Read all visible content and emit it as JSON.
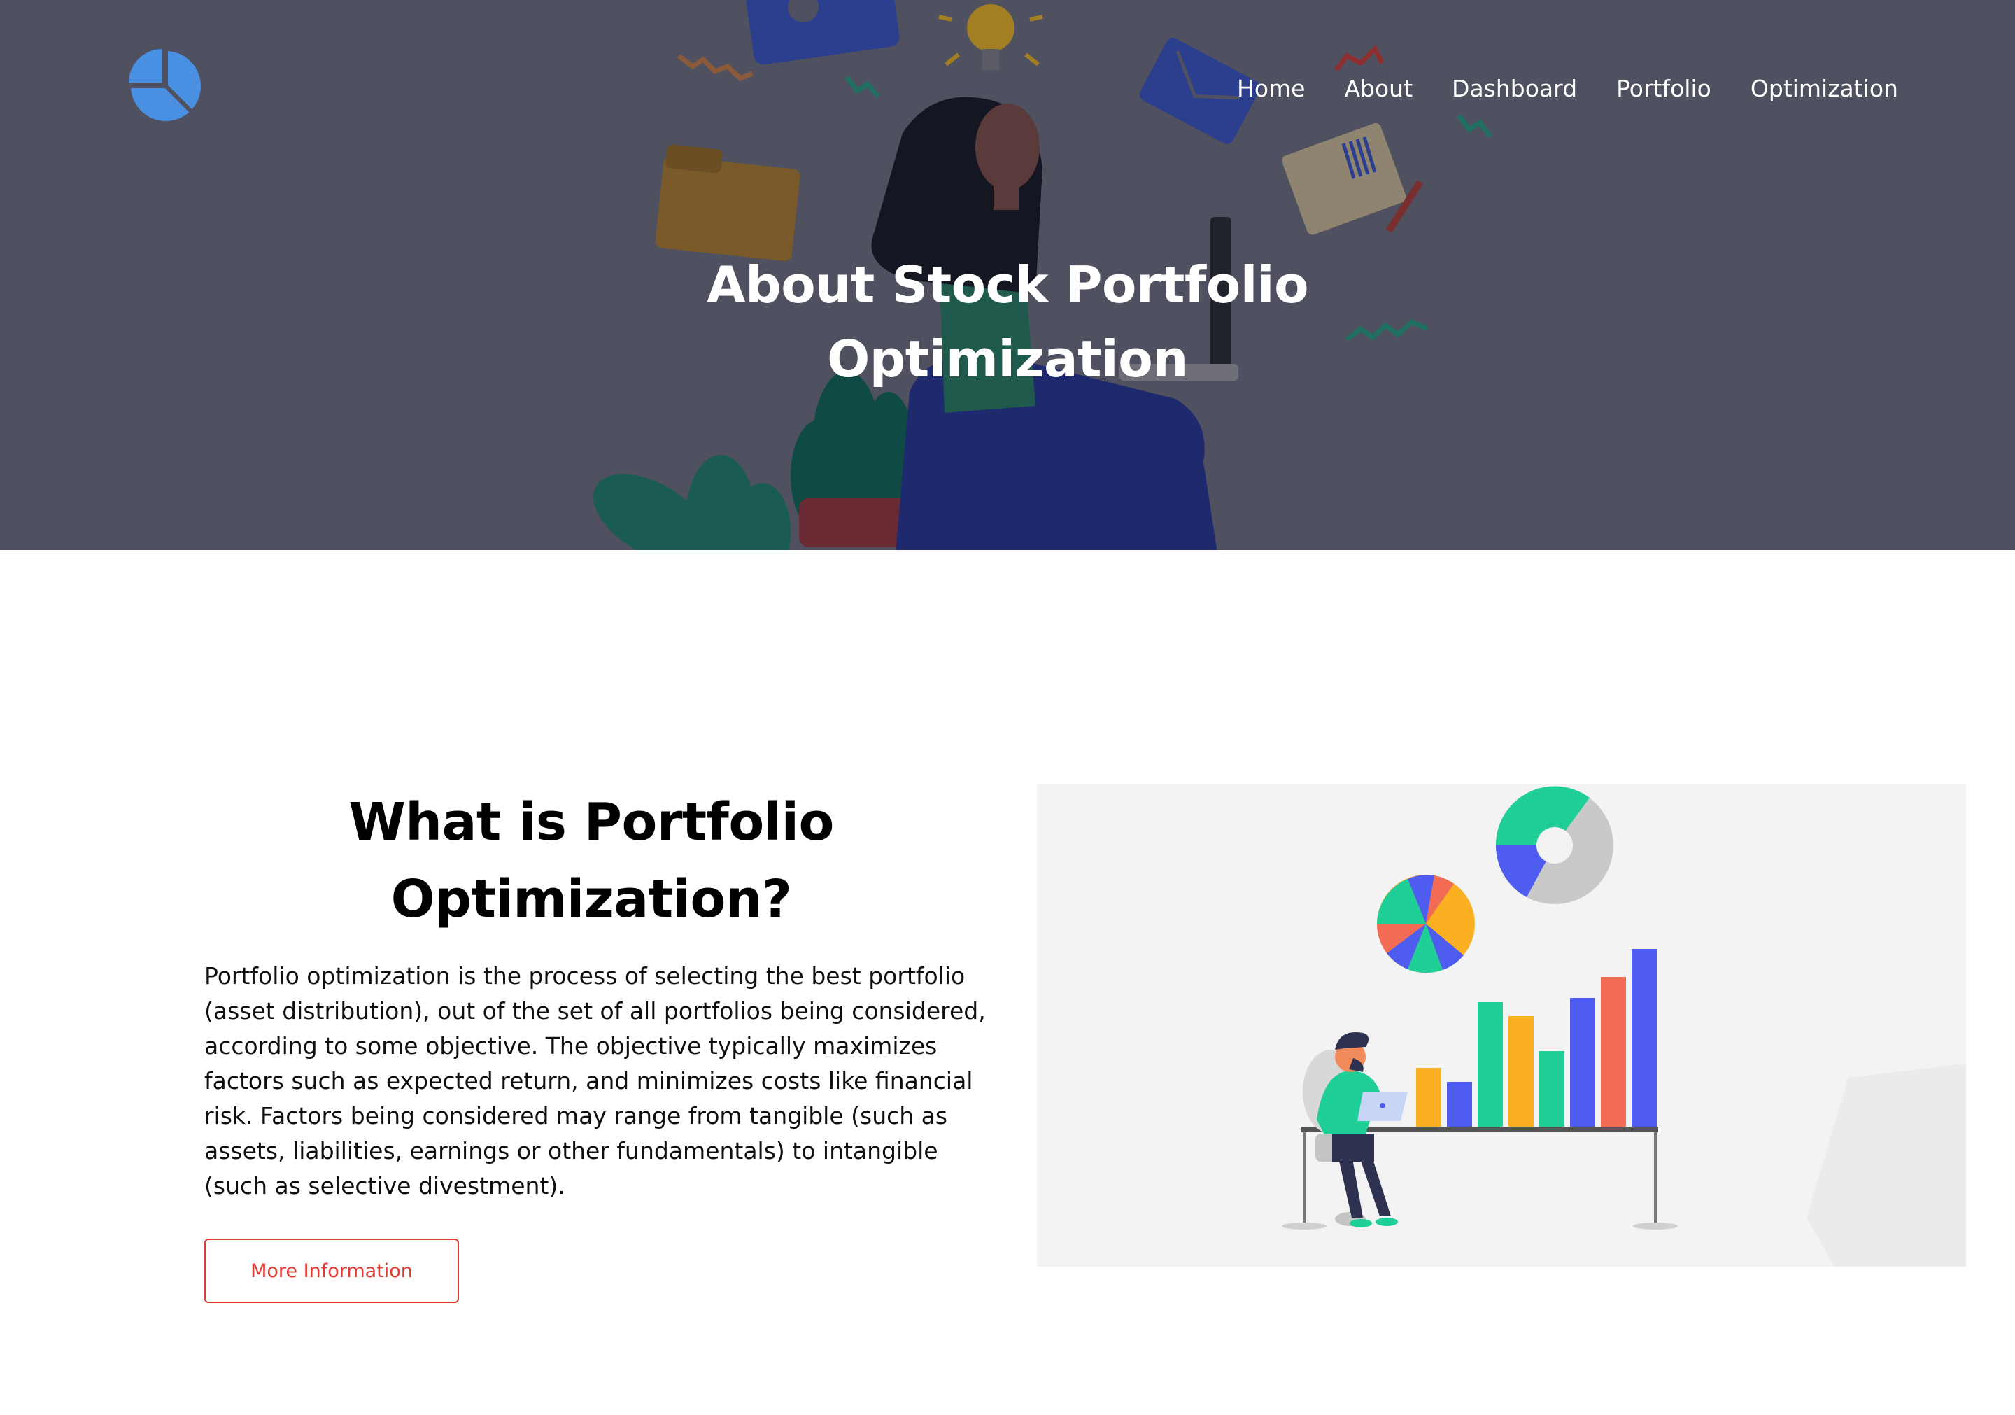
{
  "nav": {
    "items": [
      {
        "label": "Home"
      },
      {
        "label": "About"
      },
      {
        "label": "Dashboard"
      },
      {
        "label": "Portfolio"
      },
      {
        "label": "Optimization"
      }
    ]
  },
  "hero": {
    "title": "About Stock Portfolio Optimization"
  },
  "about": {
    "heading": "What is Portfolio Optimization?",
    "body": "Portfolio optimization is the process of selecting the best portfolio (asset distribution), out of the set of all portfolios being considered, according to some objective. The objective typically maximizes factors such as expected return, and minimizes costs like financial risk. Factors being considered may range from tangible (such as assets, liabilities, earnings or other fundamentals) to intangible (such as selective divestment).",
    "button_label": "More Information"
  },
  "colors": {
    "hero_overlay": "#4f5160",
    "logo": "#4a90e2",
    "button_accent": "#e03a32",
    "illustration_bg": "#f3f3f3"
  },
  "icons": {
    "logo": "pie-chart-icon"
  }
}
